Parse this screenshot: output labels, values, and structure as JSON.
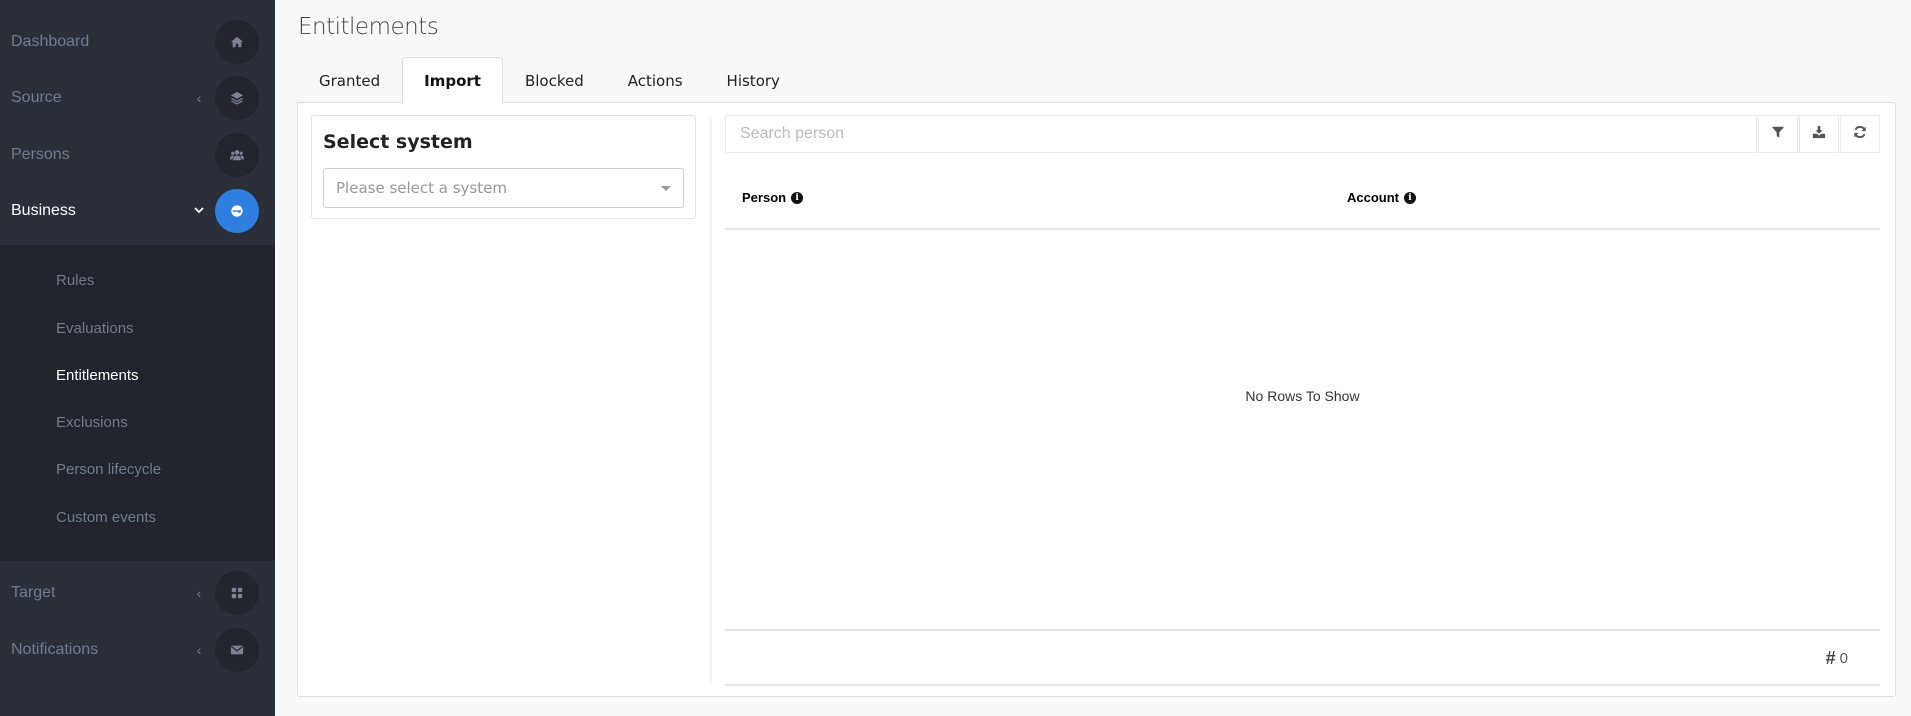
{
  "sidebar": {
    "items": [
      {
        "label": "Dashboard",
        "icon": "home-icon",
        "chevron": ""
      },
      {
        "label": "Source",
        "icon": "layers-icon",
        "chevron": "‹"
      },
      {
        "label": "Persons",
        "icon": "users-icon",
        "chevron": ""
      },
      {
        "label": "Business",
        "icon": "business-icon",
        "chevron": "⌄",
        "active": true
      },
      {
        "label": "Target",
        "icon": "grid-icon",
        "chevron": "‹"
      },
      {
        "label": "Notifications",
        "icon": "envelope-icon",
        "chevron": "‹"
      }
    ],
    "submenu": [
      {
        "label": "Rules"
      },
      {
        "label": "Evaluations"
      },
      {
        "label": "Entitlements",
        "active": true
      },
      {
        "label": "Exclusions"
      },
      {
        "label": "Person lifecycle"
      },
      {
        "label": "Custom events"
      }
    ]
  },
  "header": {
    "title": "Entitlements"
  },
  "tabs": [
    {
      "label": "Granted"
    },
    {
      "label": "Import",
      "active": true
    },
    {
      "label": "Blocked"
    },
    {
      "label": "Actions"
    },
    {
      "label": "History"
    }
  ],
  "system_select": {
    "title": "Select system",
    "placeholder": "Please select a system"
  },
  "grid": {
    "search_placeholder": "Search person",
    "tools": [
      "filter-icon",
      "download-icon",
      "refresh-icon"
    ],
    "columns": [
      {
        "label": "Person",
        "icon": "info-icon"
      },
      {
        "label": "Account",
        "icon": "info-icon"
      }
    ],
    "empty_text": "No Rows To Show",
    "row_count": "0",
    "row_count_icon": "hash-icon"
  },
  "colors": {
    "sidebar_bg": "#2b2f3a",
    "submenu_bg": "#22252e",
    "accent": "#2f7fe0"
  }
}
